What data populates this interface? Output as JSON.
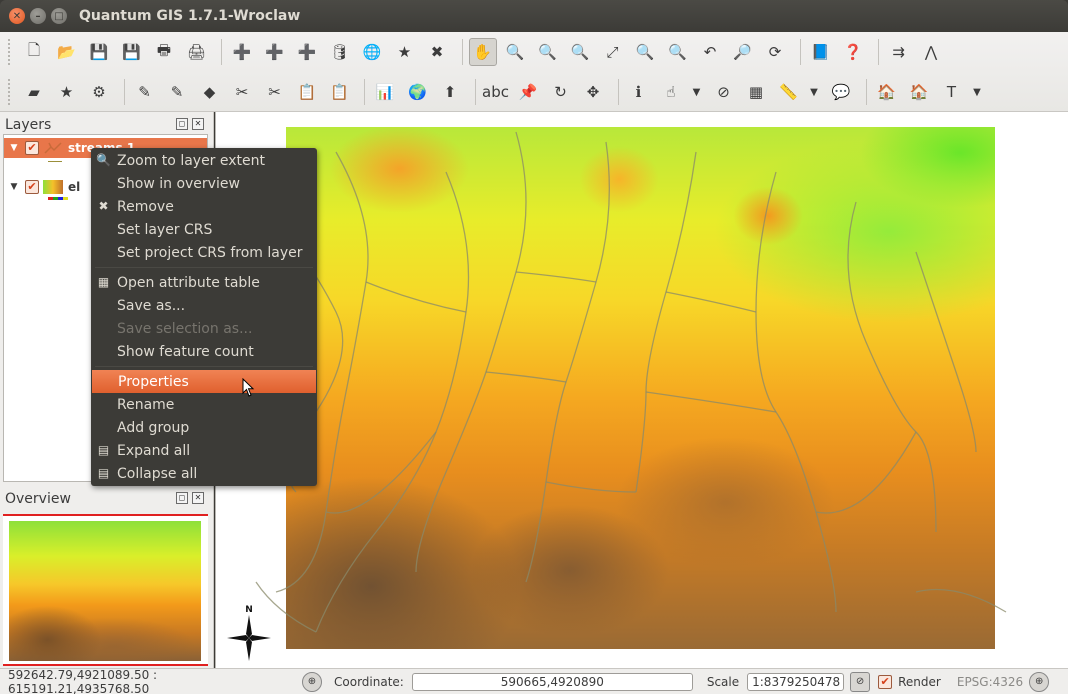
{
  "window": {
    "title": "Quantum GIS 1.7.1-Wroclaw",
    "close_glyph": "✕",
    "min_glyph": "–",
    "max_glyph": "□"
  },
  "toolbar_row1": [
    {
      "name": "new-project-icon",
      "glyph": "🗋"
    },
    {
      "name": "open-project-icon",
      "glyph": "📂"
    },
    {
      "name": "save-project-icon",
      "glyph": "💾"
    },
    {
      "name": "save-as-icon",
      "glyph": "💾"
    },
    {
      "name": "print-composer-icon",
      "glyph": "🖶"
    },
    {
      "name": "print-icon",
      "glyph": "🖨"
    },
    {
      "name": "add-vector-icon",
      "glyph": "➕"
    },
    {
      "name": "add-raster-icon",
      "glyph": "➕"
    },
    {
      "name": "add-postgis-icon",
      "glyph": "➕"
    },
    {
      "name": "add-spatialite-icon",
      "glyph": "🛢"
    },
    {
      "name": "add-wms-icon",
      "glyph": "🌐"
    },
    {
      "name": "new-shapefile-icon",
      "glyph": "★"
    },
    {
      "name": "remove-layer-icon",
      "glyph": "✖"
    },
    {
      "name": "pan-icon",
      "glyph": "✋",
      "active": true
    },
    {
      "name": "zoom-in-icon",
      "glyph": "🔍"
    },
    {
      "name": "zoom-out-icon",
      "glyph": "🔍"
    },
    {
      "name": "zoom-actual-icon",
      "glyph": "🔍"
    },
    {
      "name": "zoom-full-icon",
      "glyph": "⤢"
    },
    {
      "name": "zoom-selection-icon",
      "glyph": "🔍"
    },
    {
      "name": "zoom-layer-icon",
      "glyph": "🔍"
    },
    {
      "name": "zoom-last-icon",
      "glyph": "↶"
    },
    {
      "name": "zoom-next-icon",
      "glyph": "🔎"
    },
    {
      "name": "refresh-icon",
      "glyph": "⟳"
    },
    {
      "name": "tips-icon",
      "glyph": "📘"
    },
    {
      "name": "whats-this-icon",
      "glyph": "❓"
    },
    {
      "name": "digitize-icon",
      "glyph": "⇉"
    },
    {
      "name": "profile-icon",
      "glyph": "⋀"
    }
  ],
  "toolbar_row2": [
    {
      "name": "layer-icon",
      "glyph": "▰"
    },
    {
      "name": "add-feature-icon",
      "glyph": "★"
    },
    {
      "name": "settings-icon",
      "glyph": "⚙"
    },
    {
      "name": "edit-icon",
      "glyph": "✎"
    },
    {
      "name": "capture-icon",
      "glyph": "✎"
    },
    {
      "name": "vertex-icon",
      "glyph": "◆"
    },
    {
      "name": "delete-icon",
      "glyph": "✂"
    },
    {
      "name": "cut-icon",
      "glyph": "✂"
    },
    {
      "name": "paste-icon",
      "glyph": "📋"
    },
    {
      "name": "copy-icon",
      "glyph": "📋"
    },
    {
      "name": "measure-icon",
      "glyph": "📊"
    },
    {
      "name": "globe-icon",
      "glyph": "🌍"
    },
    {
      "name": "north-icon",
      "glyph": "⬆"
    },
    {
      "name": "label-icon",
      "glyph": "abc"
    },
    {
      "name": "pin-icon",
      "glyph": "📌"
    },
    {
      "name": "rotate-icon",
      "glyph": "↻"
    },
    {
      "name": "move-icon",
      "glyph": "✥"
    },
    {
      "name": "identify-icon",
      "glyph": "ℹ"
    },
    {
      "name": "select-icon",
      "glyph": "☝"
    },
    {
      "name": "deselect-icon",
      "glyph": "⊘"
    },
    {
      "name": "attribute-table-icon",
      "glyph": "▦"
    },
    {
      "name": "measure-line-icon",
      "glyph": "📏"
    },
    {
      "name": "annotation-icon",
      "glyph": "💬"
    },
    {
      "name": "home-icon",
      "glyph": "🏠"
    },
    {
      "name": "home2-icon",
      "glyph": "🏠"
    },
    {
      "name": "text-icon",
      "glyph": "T"
    }
  ],
  "layers": {
    "title": "Layers",
    "items": [
      {
        "label": "streams 1",
        "selected": true
      },
      {
        "label": "el"
      }
    ]
  },
  "overview": {
    "title": "Overview"
  },
  "context_menu": {
    "items": [
      {
        "label": "Zoom to layer extent",
        "icon": "🔍",
        "name": "menu-zoom-to-layer"
      },
      {
        "label": "Show in overview",
        "name": "menu-show-overview"
      },
      {
        "label": "Remove",
        "icon": "✖",
        "name": "menu-remove"
      },
      {
        "label": "Set layer CRS",
        "name": "menu-set-layer-crs"
      },
      {
        "label": "Set project CRS from layer",
        "name": "menu-set-project-crs"
      },
      {
        "sep": true
      },
      {
        "label": "Open attribute table",
        "icon": "▦",
        "name": "menu-open-attribute-table"
      },
      {
        "label": "Save as...",
        "name": "menu-save-as"
      },
      {
        "label": "Save selection as...",
        "disabled": true,
        "name": "menu-save-selection"
      },
      {
        "label": "Show feature count",
        "name": "menu-show-feature-count"
      },
      {
        "sep": true
      },
      {
        "label": "Properties",
        "highlighted": true,
        "name": "menu-properties"
      },
      {
        "label": "Rename",
        "name": "menu-rename"
      },
      {
        "label": "Add group",
        "name": "menu-add-group"
      },
      {
        "label": "Expand all",
        "icon": "▤",
        "name": "menu-expand-all"
      },
      {
        "label": "Collapse all",
        "icon": "▤",
        "name": "menu-collapse-all"
      }
    ]
  },
  "statusbar": {
    "extents": "592642.79,4921089.50 : 615191.21,4935768.50",
    "coordinate_label": "Coordinate:",
    "coordinate_value": "590665,4920890",
    "scale_label": "Scale",
    "scale_value": "1:8379250478",
    "render_label": "Render",
    "epsg": "EPSG:4326"
  },
  "north_arrow_label": "N",
  "colors": {
    "accent": "#e8764a",
    "menu_bg": "#3c3b37",
    "stream": "#8a8a6a"
  }
}
